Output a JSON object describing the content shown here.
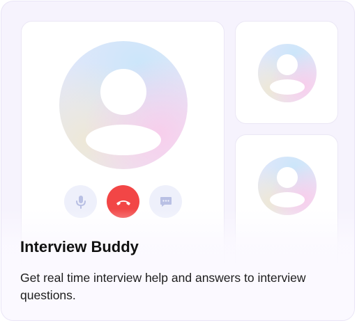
{
  "card": {
    "title": "Interview Buddy",
    "description": "Get real time interview help and answers to interview questions."
  },
  "icons": {
    "mic": "microphone-icon",
    "end_call": "phone-hangup-icon",
    "chat": "chat-bubble-icon",
    "avatar": "user-avatar-icon"
  },
  "colors": {
    "end_call": "#f24646",
    "control_bg": "#eef0fb",
    "control_icon": "#b9c0e4",
    "card_bg": "#f6f3fd"
  }
}
